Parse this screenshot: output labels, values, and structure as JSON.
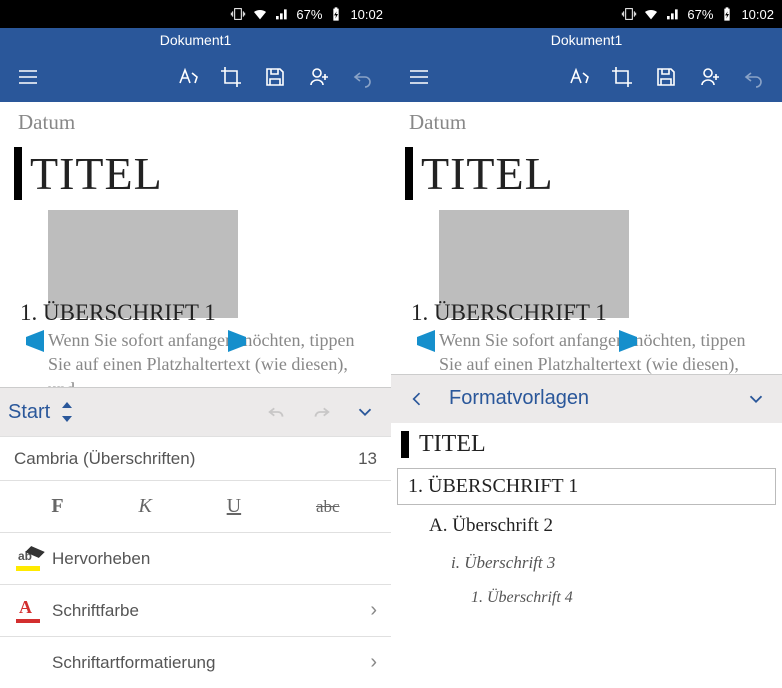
{
  "statusbar": {
    "battery": "67%",
    "time": "10:02"
  },
  "app": {
    "title": "Dokument1"
  },
  "doc": {
    "datum": "Datum",
    "titel": "TITEL",
    "heading1": "1.  ÜBERSCHRIFT 1",
    "paragraph": "Wenn Sie sofort anfangen möchten, tippen Sie auf einen Platzhaltertext (wie diesen), und"
  },
  "ribbon_start": {
    "label": "Start",
    "font_name": "Cambria (Überschriften)",
    "font_size": "13",
    "bold": "F",
    "italic": "K",
    "underline": "U",
    "strike": "abc",
    "highlight_label": "Hervorheben",
    "fontcolor_label": "Schriftfarbe",
    "formatting_label": "Schriftartformatierung"
  },
  "ribbon_styles": {
    "label": "Formatvorlagen",
    "items": {
      "titel": "TITEL",
      "h1": "1.  ÜBERSCHRIFT 1",
      "h2": "A.  Überschrift 2",
      "h3": "i.  Überschrift 3",
      "h4": "1.  Überschrift 4"
    }
  }
}
